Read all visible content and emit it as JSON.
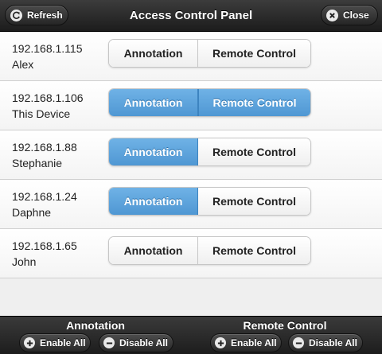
{
  "header": {
    "title": "Access Control Panel",
    "refresh_label": "Refresh",
    "close_label": "Close"
  },
  "devices": [
    {
      "ip": "192.168.1.115",
      "name": "Alex",
      "annotation_on": false,
      "remote_on": false
    },
    {
      "ip": "192.168.1.106",
      "name": "This Device",
      "annotation_on": true,
      "remote_on": true
    },
    {
      "ip": "192.168.1.88",
      "name": "Stephanie",
      "annotation_on": true,
      "remote_on": false
    },
    {
      "ip": "192.168.1.24",
      "name": "Daphne",
      "annotation_on": true,
      "remote_on": false
    },
    {
      "ip": "192.168.1.65",
      "name": "John",
      "annotation_on": false,
      "remote_on": false
    }
  ],
  "segment": {
    "annotation_label": "Annotation",
    "remote_label": "Remote Control"
  },
  "footer": {
    "annotation_title": "Annotation",
    "remote_title": "Remote Control",
    "enable_all_label": "Enable All",
    "disable_all_label": "Disable All"
  },
  "colors": {
    "active_blue": "#5aa3dc",
    "toolbar_dark": "#2a2a2a"
  },
  "icons": {
    "refresh": "refresh-icon",
    "close": "close-icon",
    "plus": "plus-icon",
    "minus": "minus-icon"
  }
}
